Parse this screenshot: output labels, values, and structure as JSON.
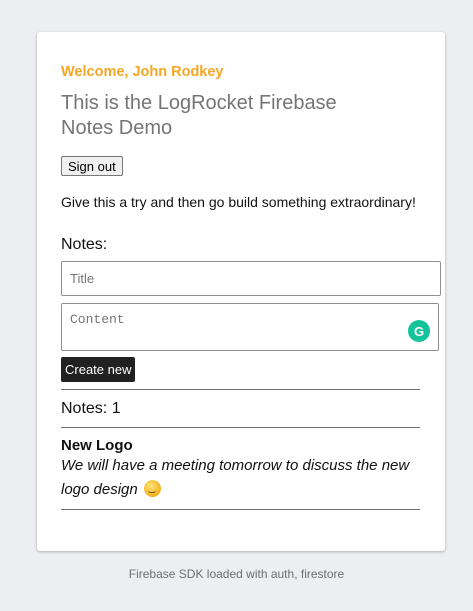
{
  "card": {
    "welcome": "Welcome, John Rodkey",
    "title": "This is the LogRocket Firebase Notes Demo",
    "sign_out_label": "Sign out",
    "tagline": "Give this a try and then go build something extraordinary!",
    "notes_label": "Notes:",
    "form": {
      "title_placeholder": "Title",
      "content_placeholder": "Content",
      "create_label": "Create new"
    },
    "notes_count": "Notes: 1",
    "notes": [
      {
        "title": "New Logo",
        "content": "We will have a meeting tomorrow to discuss the new logo design",
        "emoji_icon": "smirk-face-icon"
      }
    ]
  },
  "footer": "Firebase SDK loaded with auth, firestore",
  "colors": {
    "accent": "#f5a623",
    "button_dark": "#212121",
    "grammarly": "#15c39a"
  },
  "icons": {
    "grammarly": "grammarly-icon",
    "grammarly_letter": "G"
  }
}
